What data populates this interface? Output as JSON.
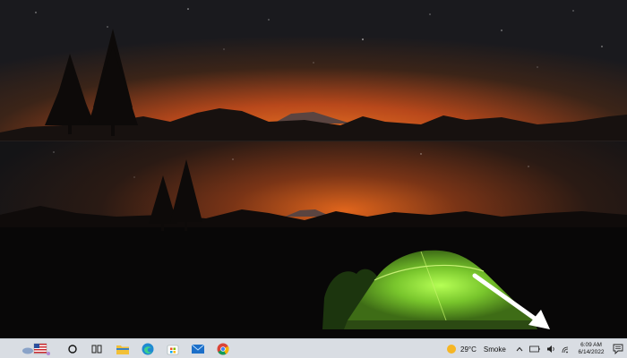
{
  "taskbar": {
    "weather_temp": "29°C",
    "weather_condition": "Smoke",
    "clock_time": "6:09 AM",
    "clock_date": "6/14/2022",
    "pinned_apps": [
      "file-explorer",
      "edge",
      "microsoft-store",
      "mail",
      "chrome"
    ]
  },
  "colors": {
    "sky_glow": "#e0651c",
    "tent": "#8ee63a",
    "taskbar": "#d9dde3",
    "arrow": "#ffffff"
  }
}
